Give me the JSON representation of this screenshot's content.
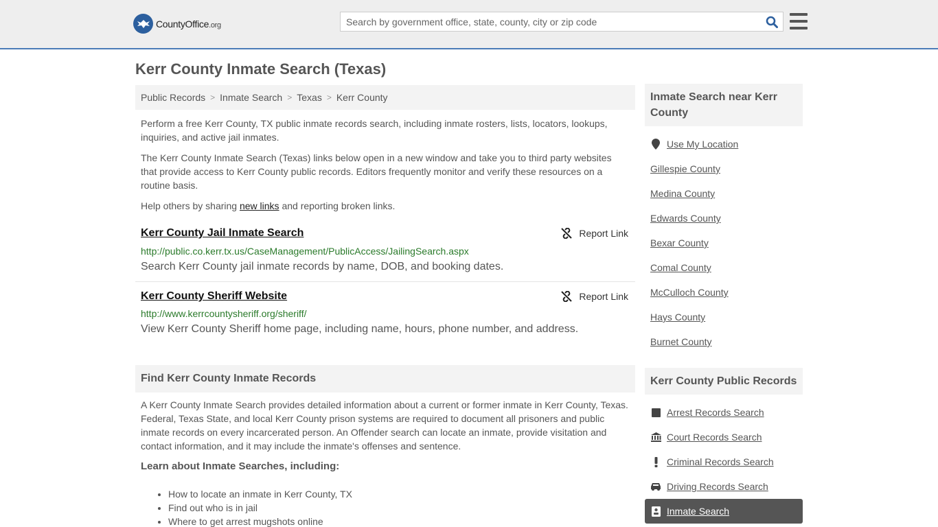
{
  "header": {
    "logo_main": "CountyOffice",
    "logo_suffix": ".org",
    "search_placeholder": "Search by government office, state, county, city or zip code"
  },
  "page_title": "Kerr County Inmate Search (Texas)",
  "breadcrumb": [
    "Public Records",
    "Inmate Search",
    "Texas",
    "Kerr County"
  ],
  "intro": {
    "p1": "Perform a free Kerr County, TX public inmate records search, including inmate rosters, lists, locators, lookups, inquiries, and active jail inmates.",
    "p2": "The Kerr County Inmate Search (Texas) links below open in a new window and take you to third party websites that provide access to Kerr County public records. Editors frequently monitor and verify these resources on a routine basis.",
    "p3_before": "Help others by sharing ",
    "p3_link": "new links",
    "p3_after": " and reporting broken links."
  },
  "links": [
    {
      "title": "Kerr County Jail Inmate Search",
      "url": "http://public.co.kerr.tx.us/CaseManagement/PublicAccess/JailingSearch.aspx",
      "desc": "Search Kerr County jail inmate records by name, DOB, and booking dates.",
      "report": "Report Link"
    },
    {
      "title": "Kerr County  Sheriff Website",
      "url": "http://www.kerrcountysheriff.org/sheriff/",
      "desc": "View Kerr County Sheriff home page, including name, hours, phone number, and address.",
      "report": "Report Link"
    }
  ],
  "find_section": {
    "heading": "Find Kerr County Inmate Records",
    "para": "A Kerr County Inmate Search provides detailed information about a current or former inmate in Kerr County, Texas. Federal, Texas State, and local Kerr County prison systems are required to document all prisoners and public inmate records on every incarcerated person. An Offender search can locate an inmate, provide visitation and contact information, and it may include the inmate's offenses and sentence.",
    "learn_heading": "Learn about Inmate Searches, including:",
    "learn_items": [
      "How to locate an inmate in Kerr County, TX",
      "Find out who is in jail",
      "Where to get arrest mugshots online"
    ]
  },
  "sidebar": {
    "nearby_heading": "Inmate Search near Kerr County",
    "use_location": "Use My Location",
    "nearby": [
      "Gillespie County",
      "Medina County",
      "Edwards County",
      "Bexar County",
      "Comal County",
      "McCulloch County",
      "Hays County",
      "Burnet County"
    ],
    "records_heading": "Kerr County Public Records",
    "records": [
      "Arrest Records Search",
      "Court Records Search",
      "Criminal Records Search",
      "Driving Records Search"
    ],
    "records_active": "Inmate Search"
  }
}
